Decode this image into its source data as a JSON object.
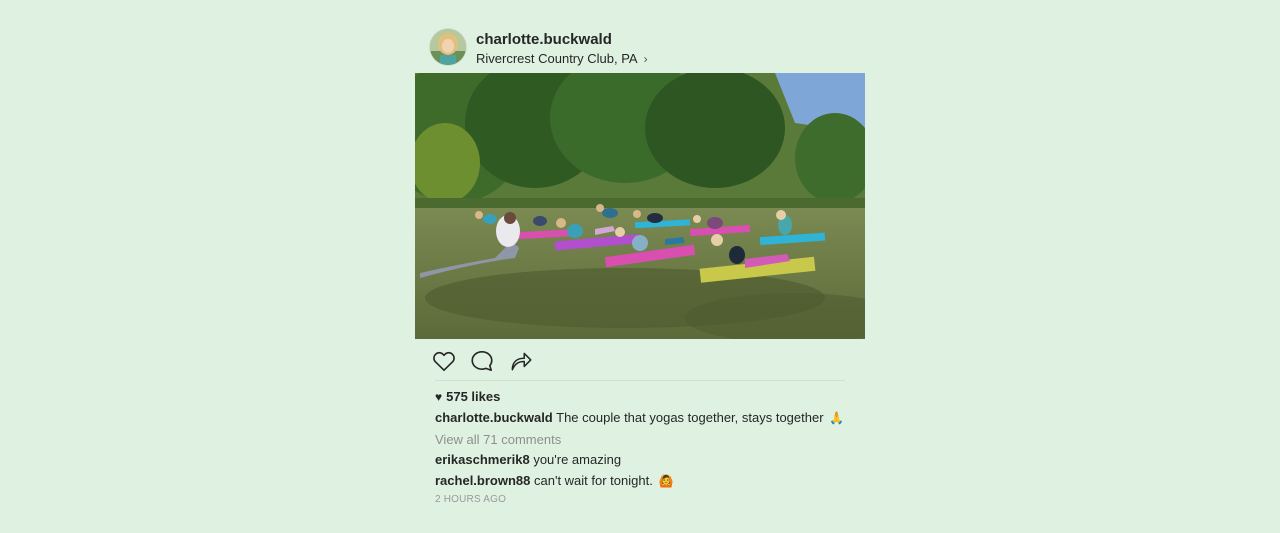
{
  "post": {
    "username": "charlotte.buckwald",
    "location": "Rivercrest Country Club, PA",
    "location_chevron": "›",
    "image_description_icon": "photo-icon",
    "actions": {
      "like_icon": "heart-outline-icon",
      "comment_icon": "comment-bubble-icon",
      "share_icon": "share-arrow-icon"
    },
    "likes_heart": "♥",
    "likes": "575 likes",
    "caption": {
      "user": "charlotte.buckwald",
      "text": "The couple that yogas together, stays together",
      "emoji": "🙏"
    },
    "view_all_comments": "View all 71 comments",
    "comments": [
      {
        "user": "erikaschmerik8",
        "text": "you're amazing",
        "emoji": ""
      },
      {
        "user": "rachel.brown88",
        "text": "can't wait for tonight.",
        "emoji": "🙆"
      }
    ],
    "timestamp": "2 HOURS AGO"
  },
  "colors": {
    "background": "#dff2e2",
    "text": "#262626",
    "muted": "#8e8e8e"
  }
}
